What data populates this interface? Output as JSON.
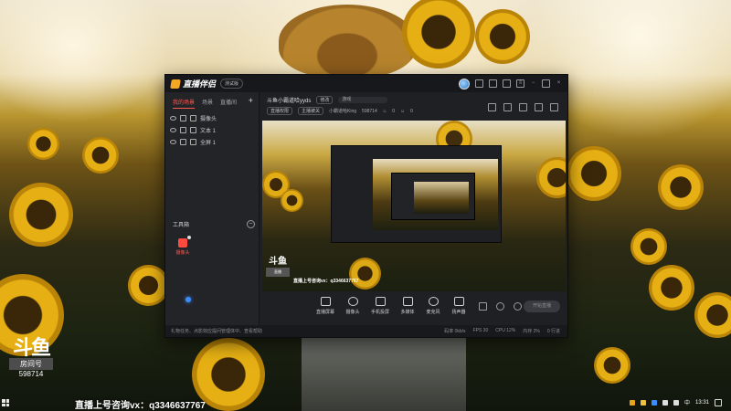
{
  "app": {
    "title": "直播伴侣",
    "version_badge": "测试版",
    "window_controls": [
      "minimize-icon",
      "maximize-icon",
      "close-icon"
    ]
  },
  "sidebar": {
    "tabs": [
      {
        "label": "我的场景",
        "active": true
      },
      {
        "label": "场景",
        "active": false
      },
      {
        "label": "直播间",
        "active": false
      }
    ],
    "add_label": "+",
    "layers": [
      {
        "label": "摄像头"
      },
      {
        "label": "文本 1"
      },
      {
        "label": "全屏 1"
      }
    ],
    "tools_header": "工具箱",
    "tools_collapse": "−",
    "tool_items": [
      {
        "label": "摄像头"
      }
    ]
  },
  "topbar": {
    "room_name": "斗鱼小霸道哈yyds",
    "edit_label": "修改",
    "category_label": "游戏",
    "tag1": "直播权限",
    "tag2": "主播被关",
    "anchor": "小霸道哈King",
    "room_id": "598714",
    "hot": "0",
    "viewers": "0"
  },
  "preview": {
    "brand": "斗鱼",
    "brand_sub": "直播",
    "caption": "直播上号咨询vx：q3346637767"
  },
  "controls": {
    "items": [
      {
        "label": "直播屏幕",
        "icon": "screen-icon"
      },
      {
        "label": "摄像头",
        "icon": "camera-icon"
      },
      {
        "label": "手机投屏",
        "icon": "phone-icon"
      },
      {
        "label": "多媒体",
        "icon": "media-icon"
      },
      {
        "label": "麦克风",
        "icon": "mic-icon"
      },
      {
        "label": "扬声器",
        "icon": "speaker-icon"
      }
    ],
    "start_label": "开始直播"
  },
  "statusbar": {
    "notice": "礼物任务、点影效应提问管理体中、查看帮助",
    "stats": [
      "码率 0kb/s",
      "FPS 30",
      "CPU 12%",
      "内存 2%",
      "0 行进"
    ]
  },
  "overlay": {
    "logo_main": "斗鱼",
    "logo_sub": "房间号",
    "room_number": "598714",
    "bottom_caption": "直播上号咨询vx：q3346637767"
  },
  "taskbar": {
    "time": "13:31",
    "lang": "中"
  }
}
